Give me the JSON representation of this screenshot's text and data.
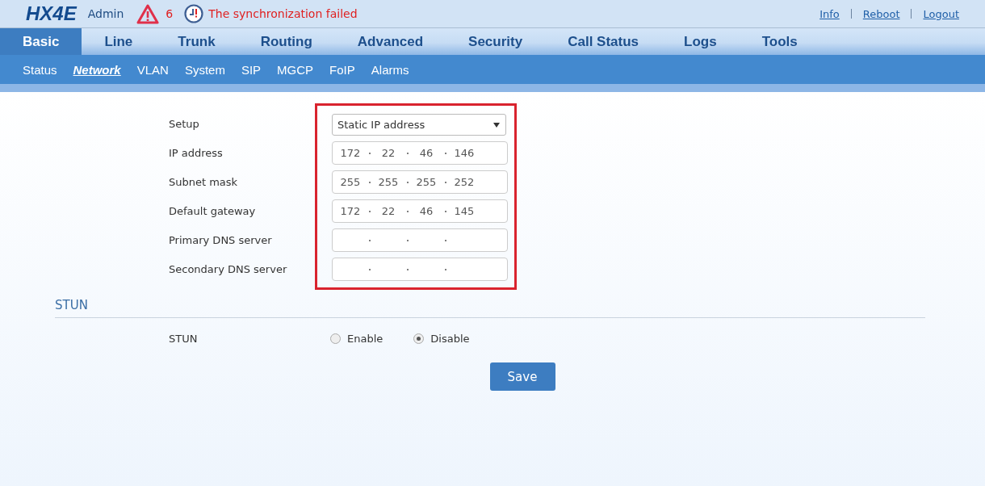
{
  "header": {
    "logo": "HX4E",
    "user": "Admin",
    "alarm_count": "6",
    "sync_message": "The synchronization failed",
    "links": [
      "Info",
      "Reboot",
      "Logout"
    ]
  },
  "main_tabs": [
    {
      "label": "Basic",
      "selected": true
    },
    {
      "label": "Line",
      "selected": false
    },
    {
      "label": "Trunk",
      "selected": false
    },
    {
      "label": "Routing",
      "selected": false
    },
    {
      "label": "Advanced",
      "selected": false
    },
    {
      "label": "Security",
      "selected": false
    },
    {
      "label": "Call Status",
      "selected": false
    },
    {
      "label": "Logs",
      "selected": false
    },
    {
      "label": "Tools",
      "selected": false
    }
  ],
  "sub_tabs": [
    {
      "label": "Status",
      "selected": false
    },
    {
      "label": "Network",
      "selected": true
    },
    {
      "label": "VLAN",
      "selected": false
    },
    {
      "label": "System",
      "selected": false
    },
    {
      "label": "SIP",
      "selected": false
    },
    {
      "label": "MGCP",
      "selected": false
    },
    {
      "label": "FoIP",
      "selected": false
    },
    {
      "label": "Alarms",
      "selected": false
    }
  ],
  "network": {
    "fields": [
      {
        "kind": "select",
        "label": "Setup",
        "value": "Static IP address"
      },
      {
        "kind": "ip",
        "label": "IP address",
        "octets": [
          "172",
          "22",
          "46",
          "146"
        ]
      },
      {
        "kind": "ip",
        "label": "Subnet mask",
        "octets": [
          "255",
          "255",
          "255",
          "252"
        ]
      },
      {
        "kind": "ip",
        "label": "Default gateway",
        "octets": [
          "172",
          "22",
          "46",
          "145"
        ]
      },
      {
        "kind": "ip",
        "label": "Primary DNS server"
      },
      {
        "kind": "ip",
        "label": "Secondary DNS server"
      }
    ]
  },
  "stun": {
    "heading": "STUN",
    "label": "STUN",
    "options": [
      {
        "label": "Enable",
        "selected": false
      },
      {
        "label": "Disable",
        "selected": true
      }
    ]
  },
  "save_button": "Save"
}
